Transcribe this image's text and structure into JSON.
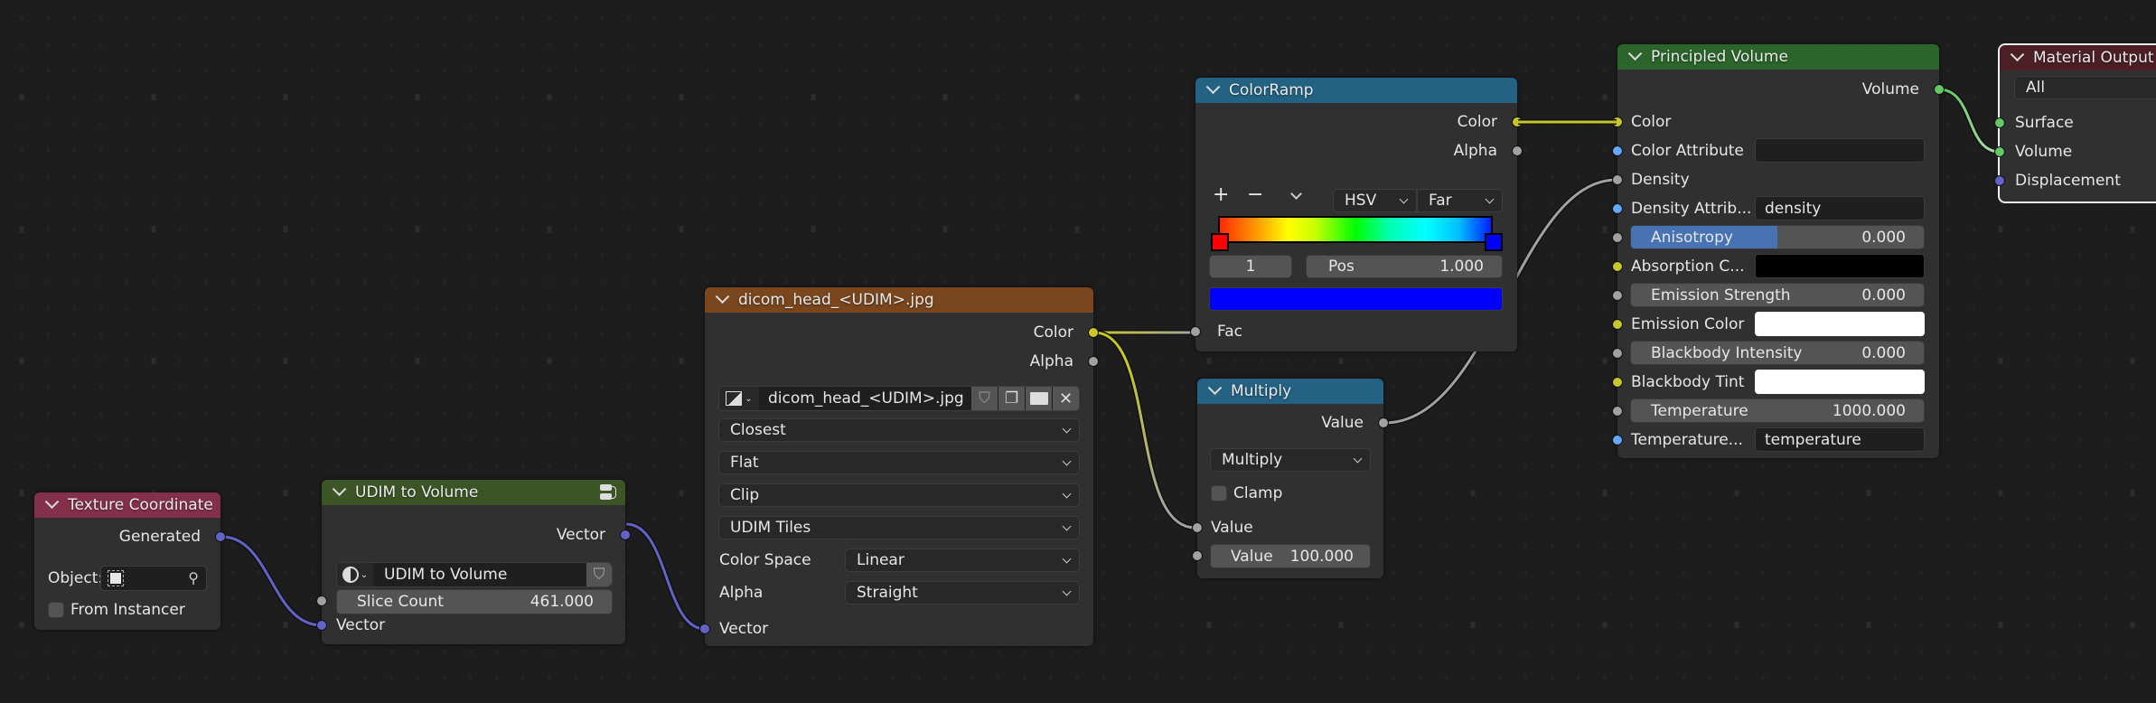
{
  "editor": "Shader Node Editor",
  "colors": {
    "background": "#1d1d1d",
    "node_body": "#303030",
    "header_input": "#83314a",
    "header_group": "#3b5527",
    "header_texture": "#79461d",
    "header_converter": "#246283",
    "header_shader": "#2b652b",
    "header_output": "#4c1f27",
    "socket_color": "#c7c729",
    "socket_float": "#a1a1a1",
    "socket_vector": "#6363c7",
    "socket_string": "#63a8ff",
    "socket_shader": "#63c763"
  },
  "nodes": {
    "texture_coordinate": {
      "title": "Texture Coordinate",
      "outputs": [
        "Generated"
      ],
      "object_label": "Object:",
      "from_instancer_label": "From Instancer",
      "from_instancer_checked": false
    },
    "udim_to_volume": {
      "title": "UDIM to Volume",
      "outputs": [
        "Vector"
      ],
      "group_name": "UDIM to Volume",
      "slice_count_label": "Slice Count",
      "slice_count_value": "461.000",
      "inputs": [
        "Vector"
      ]
    },
    "image_texture": {
      "title": "dicom_head_<UDIM>.jpg",
      "outputs": [
        "Color",
        "Alpha"
      ],
      "image_name": "dicom_head_<UDIM>.jpg",
      "interpolation": "Closest",
      "projection": "Flat",
      "extension": "Clip",
      "source": "UDIM Tiles",
      "color_space_label": "Color Space",
      "color_space_value": "Linear",
      "alpha_label": "Alpha",
      "alpha_value": "Straight",
      "inputs": [
        "Vector"
      ]
    },
    "color_ramp": {
      "title": "ColorRamp",
      "outputs": [
        "Color",
        "Alpha"
      ],
      "add_label": "+",
      "remove_label": "−",
      "color_mode": "HSV",
      "hue_interpolation": "Far",
      "active_stop_index": "1",
      "pos_label": "Pos",
      "pos_value": "1.000",
      "stops": [
        {
          "position": 0.0,
          "color": "#ff0000"
        },
        {
          "position": 1.0,
          "color": "#0000ff"
        }
      ],
      "active_color": "#0000ff",
      "inputs": [
        "Fac"
      ]
    },
    "multiply": {
      "title": "Multiply",
      "outputs": [
        "Value"
      ],
      "operation": "Multiply",
      "clamp_label": "Clamp",
      "clamp_checked": false,
      "input_value_label": "Value",
      "value2_label": "Value",
      "value2_value": "100.000"
    },
    "principled_volume": {
      "title": "Principled Volume",
      "outputs": [
        "Volume"
      ],
      "color_label": "Color",
      "color_attribute_label": "Color Attribute",
      "color_attribute_value": "",
      "density_label": "Density",
      "density_attribute_label": "Density Attrib...",
      "density_attribute_value": "density",
      "anisotropy_label": "Anisotropy",
      "anisotropy_value": "0.000",
      "anisotropy_fill": 0.5,
      "absorption_label": "Absorption C...",
      "absorption_color": "#000000",
      "emission_strength_label": "Emission Strength",
      "emission_strength_value": "0.000",
      "emission_color_label": "Emission Color",
      "emission_color": "#ffffff",
      "blackbody_intensity_label": "Blackbody Intensity",
      "blackbody_intensity_value": "0.000",
      "blackbody_tint_label": "Blackbody Tint",
      "blackbody_tint": "#ffffff",
      "temperature_label": "Temperature",
      "temperature_value": "1000.000",
      "temperature_attribute_label": "Temperature...",
      "temperature_attribute_value": "temperature"
    },
    "material_output": {
      "title": "Material Output",
      "target": "All",
      "inputs": [
        "Surface",
        "Volume",
        "Displacement"
      ]
    }
  }
}
